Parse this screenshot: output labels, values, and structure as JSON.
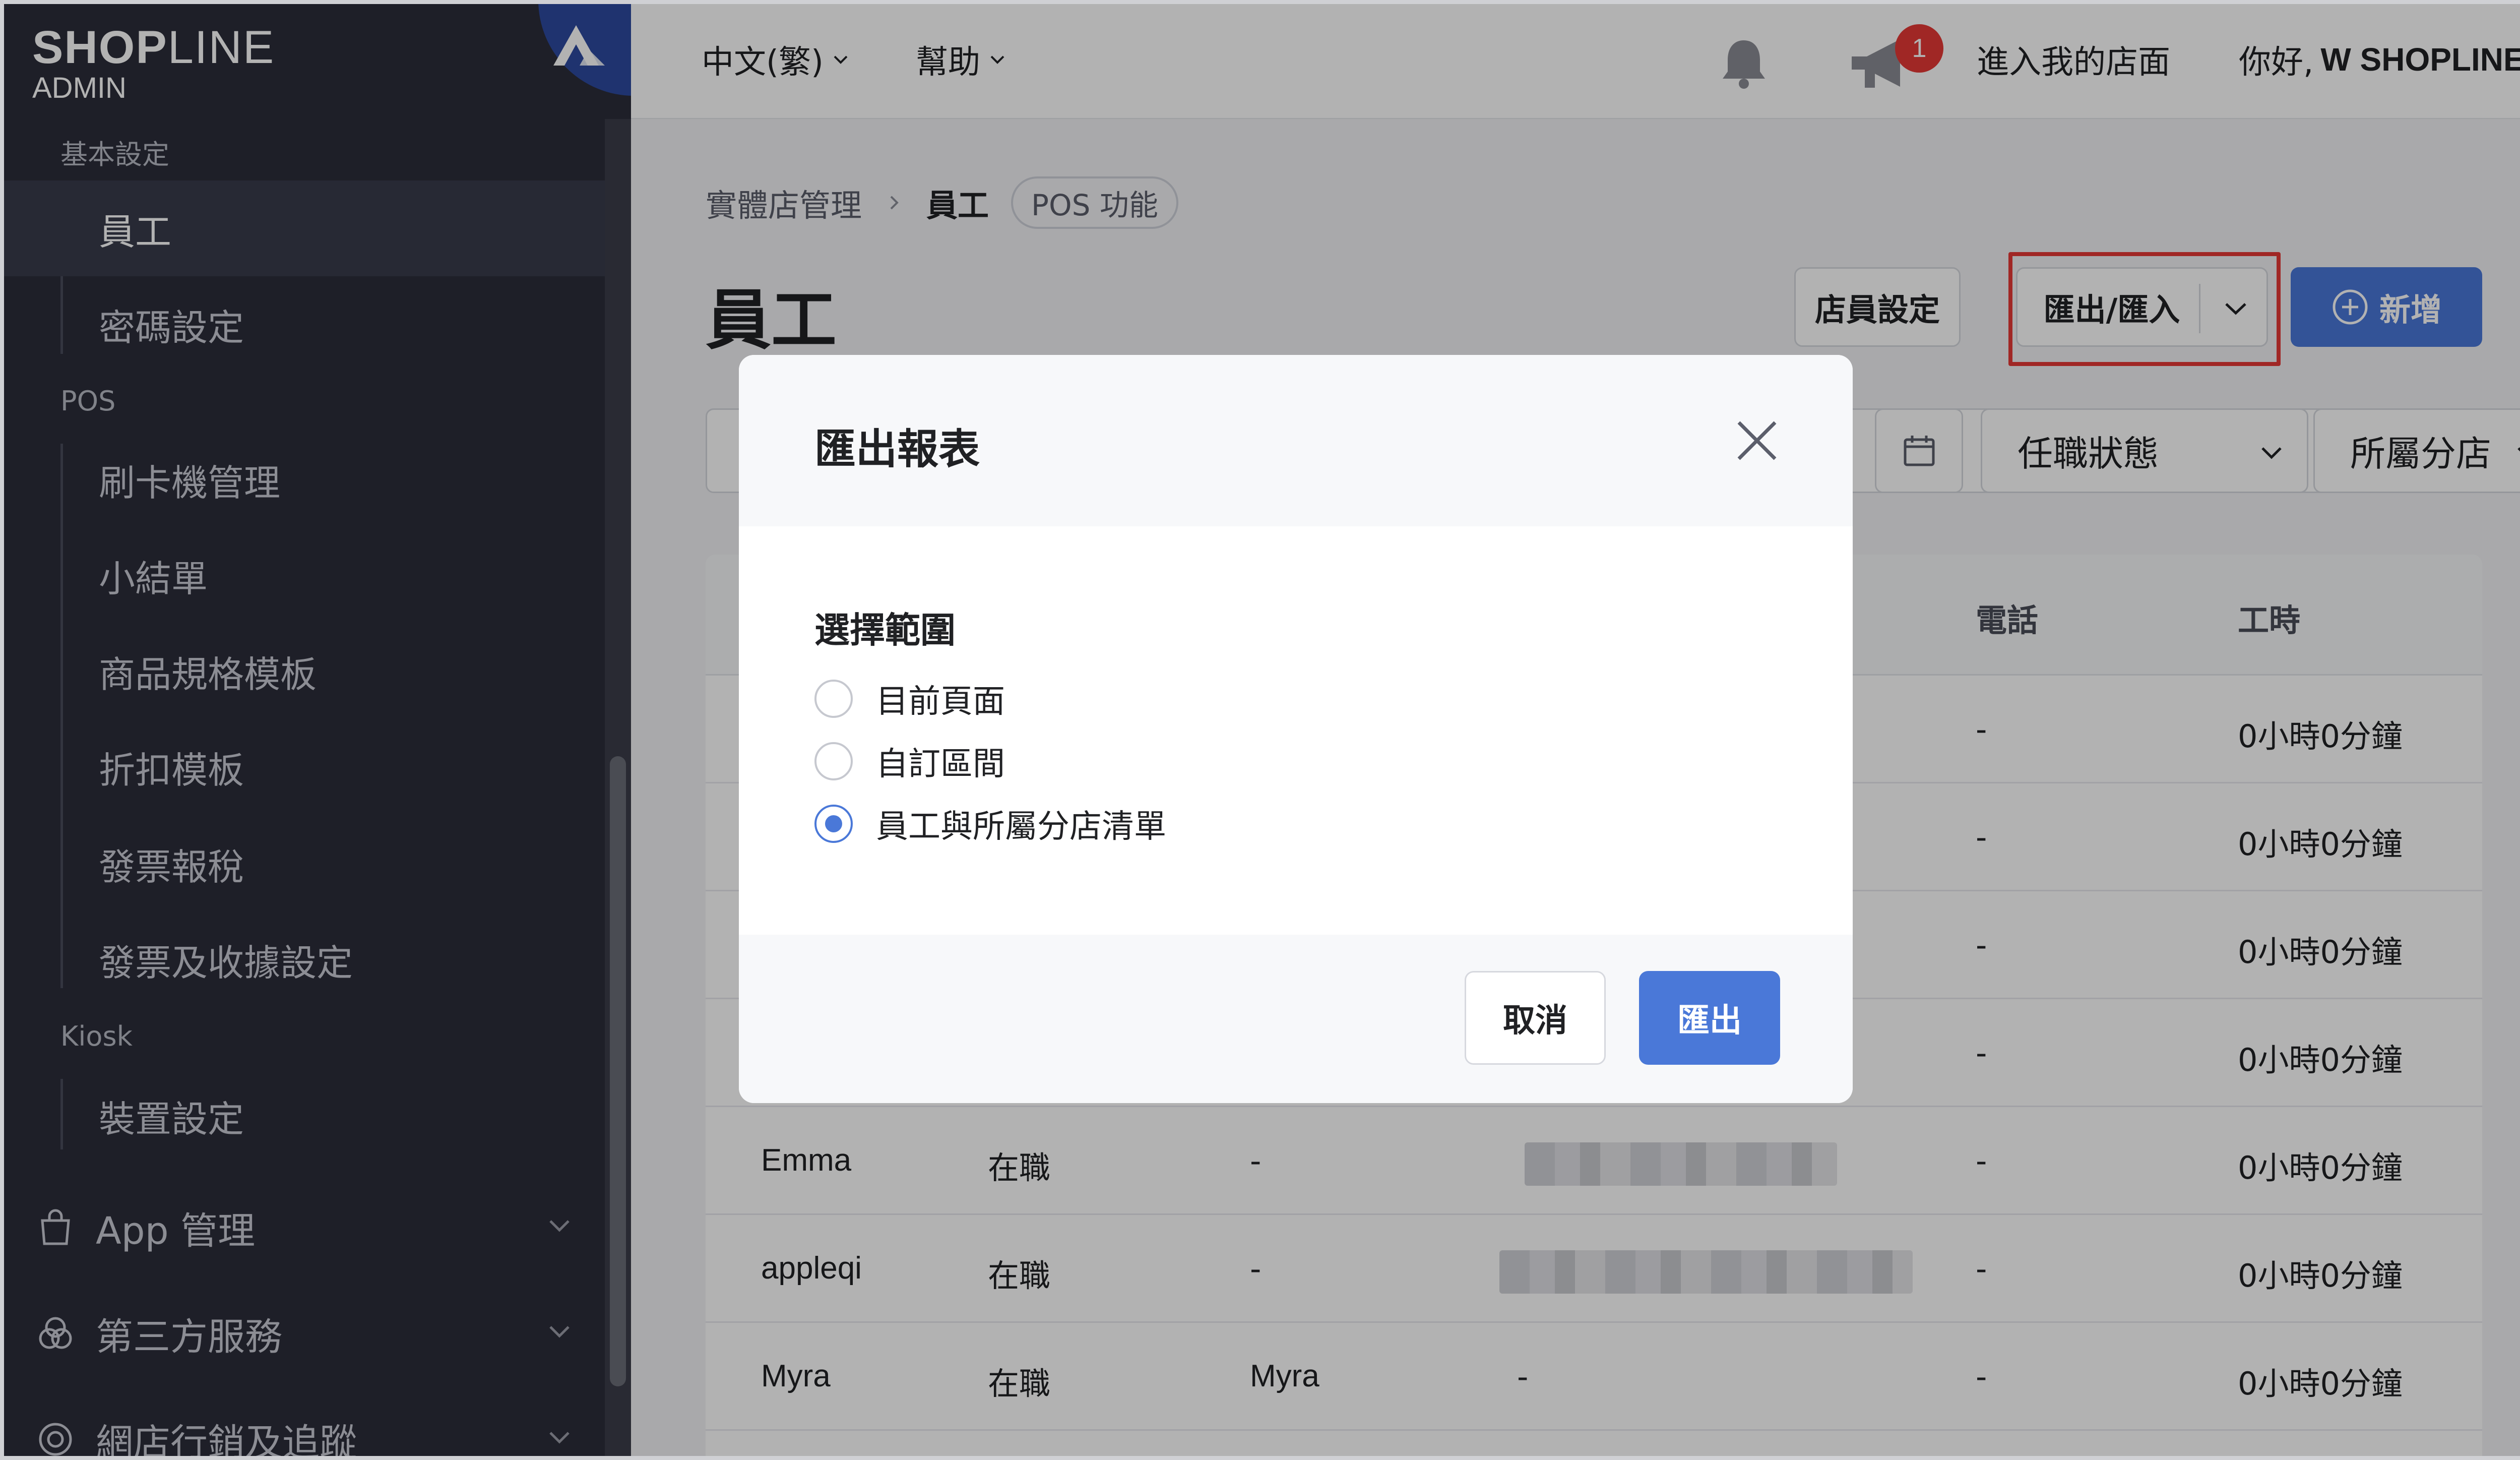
{
  "logo": {
    "brand_bold": "SHOP",
    "brand_light": "LINE",
    "sub": "ADMIN"
  },
  "topbar": {
    "language": "中文(繁)",
    "help": "幫助",
    "notification_count": "1",
    "storefront_link": "進入我的店面",
    "greeting": "你好,",
    "user_name": "W SHOPLINE"
  },
  "sidebar": {
    "sections": [
      {
        "label": "基本設定",
        "items": [
          "員工",
          "密碼設定"
        ]
      },
      {
        "label": "POS",
        "items": [
          "刷卡機管理",
          "小結單",
          "商品規格模板",
          "折扣模板",
          "發票報稅",
          "發票及收據設定"
        ]
      },
      {
        "label": "Kiosk",
        "items": [
          "裝置設定"
        ]
      }
    ],
    "active_item": "員工",
    "groups": [
      "App 管理",
      "第三方服務",
      "網店行銷及追蹤"
    ]
  },
  "breadcrumb": {
    "parent": "實體店管理",
    "current": "員工",
    "tag": "POS 功能"
  },
  "page": {
    "title": "員工",
    "staff_settings_button": "店員設定",
    "export_import_button": "匯出/匯入",
    "add_button": "新增"
  },
  "filters": {
    "status": "任職狀態",
    "store": "所屬分店"
  },
  "table": {
    "headers": {
      "phone": "電話",
      "hours": "工時"
    },
    "rows": [
      {
        "name": "",
        "status": "",
        "nickname": "",
        "email": "",
        "phone": "-",
        "hours": "0小時0分鐘"
      },
      {
        "name": "",
        "status": "",
        "nickname": "",
        "email": "",
        "phone": "-",
        "hours": "0小時0分鐘"
      },
      {
        "name": "",
        "status": "",
        "nickname": "",
        "email": "",
        "phone": "-",
        "hours": "0小時0分鐘"
      },
      {
        "name": "",
        "status": "",
        "nickname": "",
        "email": "",
        "phone": "-",
        "hours": "0小時0分鐘"
      },
      {
        "name": "Emma",
        "status": "在職",
        "nickname": "-",
        "email": "",
        "phone": "-",
        "hours": "0小時0分鐘"
      },
      {
        "name": "appleqi",
        "status": "在職",
        "nickname": "-",
        "email": "",
        "phone": "-",
        "hours": "0小時0分鐘"
      },
      {
        "name": "Myra",
        "status": "在職",
        "nickname": "Myra",
        "email": "-",
        "phone": "-",
        "hours": "0小時0分鐘"
      }
    ]
  },
  "modal": {
    "title": "匯出報表",
    "section_label": "選擇範圍",
    "options": [
      {
        "label": "目前頁面",
        "checked": false
      },
      {
        "label": "自訂區間",
        "checked": false
      },
      {
        "label": "員工與所屬分店清單",
        "checked": true
      }
    ],
    "cancel_button": "取消",
    "export_button": "匯出"
  },
  "colors": {
    "sidebar_bg": "#2b2d3a",
    "primary": "#4a78d8",
    "highlight": "#e53935",
    "badge": "#e53935"
  }
}
